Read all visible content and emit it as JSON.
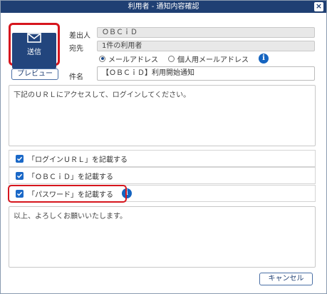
{
  "dialog": {
    "title": "利用者 - 通知内容確認",
    "close_label": "×"
  },
  "send_button": {
    "label": "送信"
  },
  "sender": {
    "label": "差出人",
    "value": "ＯＢＣｉＤ"
  },
  "recipient": {
    "label": "宛先",
    "value": "1件の利用者",
    "options": [
      {
        "label": "メールアドレス",
        "selected": true
      },
      {
        "label": "個人用メールアドレス",
        "selected": false
      }
    ]
  },
  "preview_button": {
    "label": "プレビュー"
  },
  "subject": {
    "label": "件名",
    "value": "【ＯＢＣｉＤ】利用開始通知"
  },
  "body_top": "下記のＵＲＬにアクセスして、ログインしてください。",
  "checkboxes": [
    {
      "label": "「ログインＵＲＬ」を記載する",
      "checked": true
    },
    {
      "label": "「ＯＢＣｉＤ」を記載する",
      "checked": true
    },
    {
      "label": "「パスワード」を記載する",
      "checked": true
    }
  ],
  "body_bottom": "以上、よろしくお願いいたします。",
  "cancel_button": {
    "label": "キャンセル"
  },
  "info_glyph": "i"
}
